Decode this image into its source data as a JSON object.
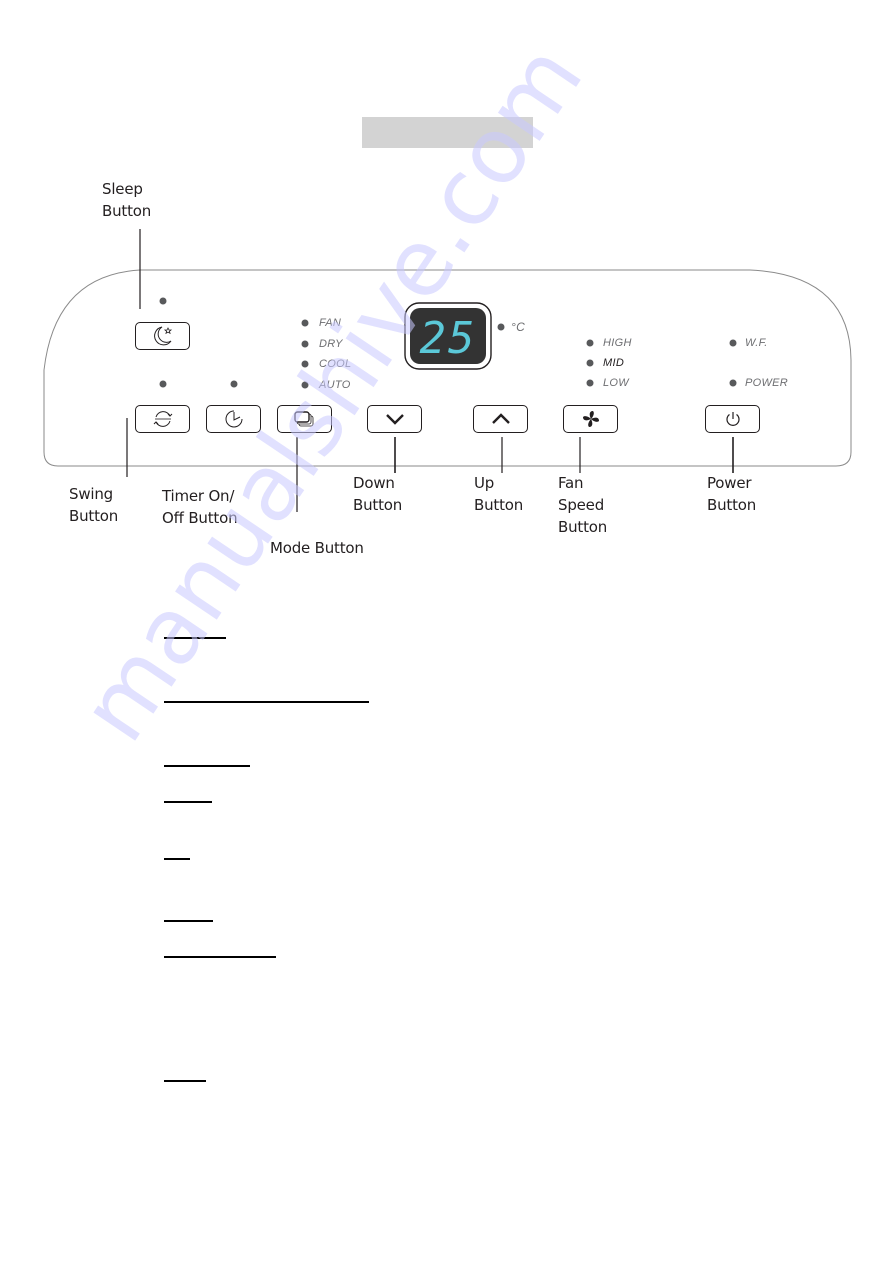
{
  "page": {
    "heading_placeholder": "",
    "watermark": "manualshive.com"
  },
  "callouts": {
    "sleep": "Sleep\nButton",
    "swing": "Swing\nButton",
    "timer": "Timer On/\nOff Button",
    "mode": "Mode Button",
    "down": "Down\nButton",
    "up": "Up\nButton",
    "fan_speed": "Fan\nSpeed\nButton",
    "power": "Power\nButton"
  },
  "display": {
    "temperature": "25",
    "unit": "°C",
    "digit_color": "#5bc8d8",
    "background_color": "#333333"
  },
  "mode_indicators": [
    "FAN",
    "DRY",
    "COOL",
    "AUTO"
  ],
  "fan_indicators": [
    "HIGH",
    "MID",
    "LOW"
  ],
  "status_indicators": {
    "wf": "W.F.",
    "power": "POWER"
  },
  "buttons": [
    {
      "id": "sleep",
      "icon": "moon-star-icon"
    },
    {
      "id": "swing",
      "icon": "swing-arrows-icon"
    },
    {
      "id": "timer",
      "icon": "clock-icon"
    },
    {
      "id": "mode",
      "icon": "stacked-squares-icon"
    },
    {
      "id": "down",
      "icon": "chevron-down-icon"
    },
    {
      "id": "up",
      "icon": "chevron-up-icon"
    },
    {
      "id": "fan_speed",
      "icon": "fan-icon"
    },
    {
      "id": "power",
      "icon": "power-icon"
    }
  ],
  "descriptions": [
    {
      "title": ""
    },
    {
      "title": ""
    },
    {
      "title": ""
    },
    {
      "title": ""
    },
    {
      "title": ""
    },
    {
      "title": ""
    },
    {
      "title": ""
    },
    {
      "title": ""
    }
  ]
}
